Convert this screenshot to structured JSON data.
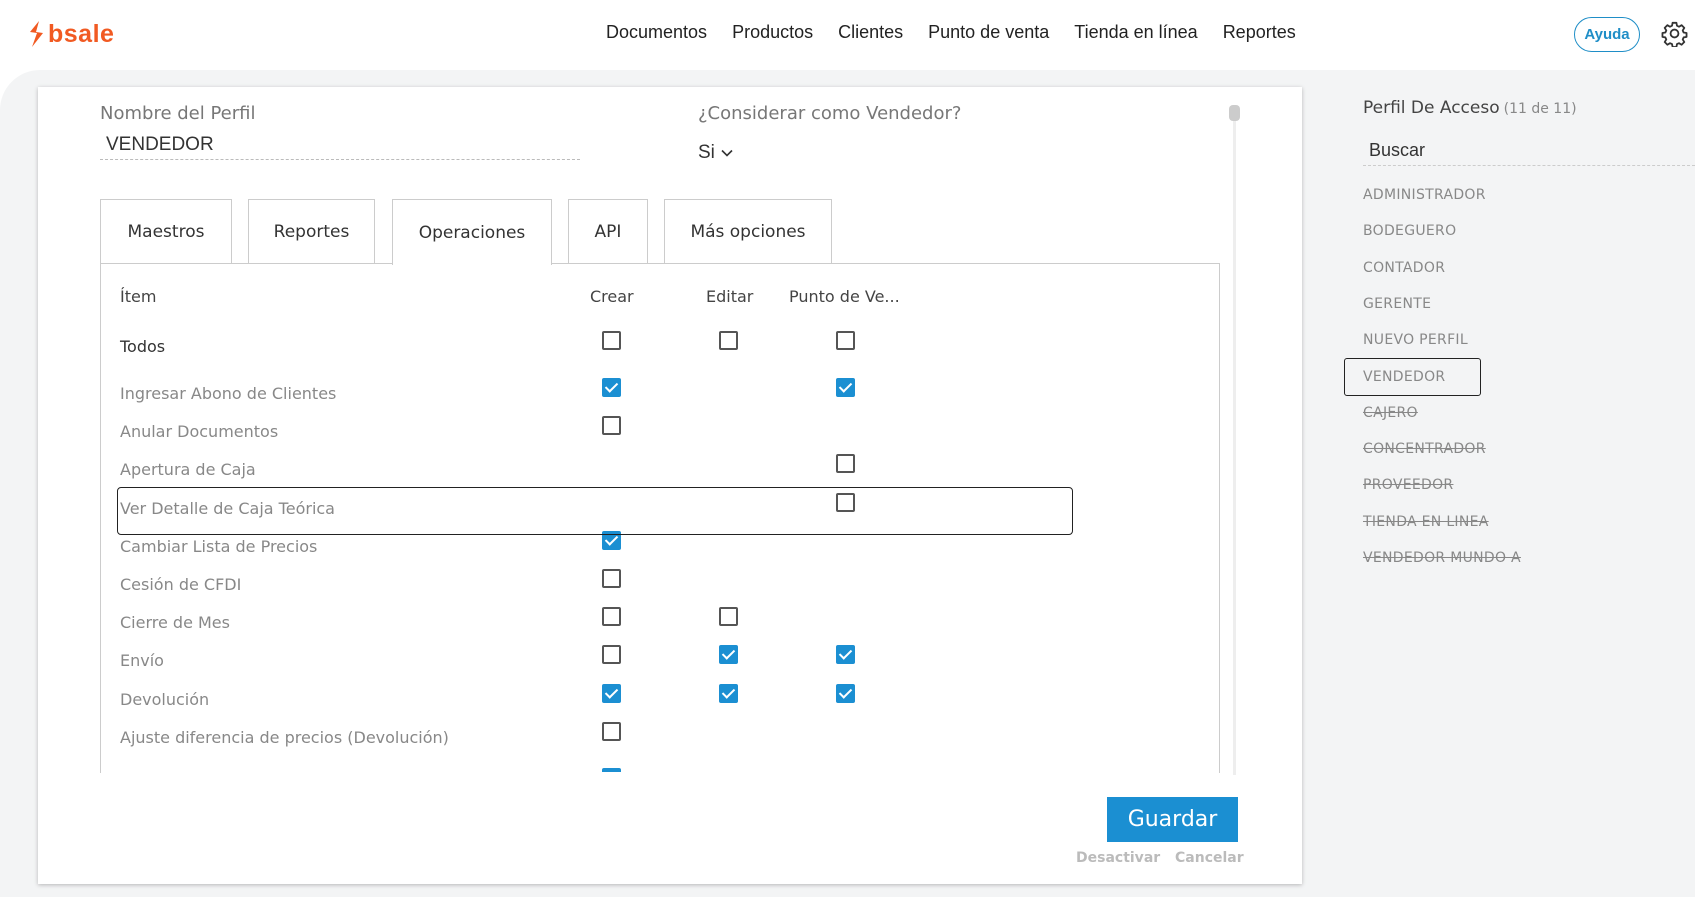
{
  "app": {
    "logo_text": "bsale",
    "brand_color": "#f15a22",
    "accent_color": "#1b8fd2"
  },
  "nav": [
    "Documentos",
    "Productos",
    "Clientes",
    "Punto de venta",
    "Tienda en línea",
    "Reportes"
  ],
  "header": {
    "help_label": "Ayuda",
    "settings_icon": "gear-icon"
  },
  "form": {
    "profile_name_label": "Nombre del Perfil",
    "profile_name_value": "VENDEDOR",
    "seller_label": "¿Considerar como Vendedor?",
    "seller_value": "Si"
  },
  "tabs": [
    "Maestros",
    "Reportes",
    "Operaciones",
    "API",
    "Más opciones"
  ],
  "active_tab": "Operaciones",
  "table": {
    "headers": {
      "item": "Ítem",
      "crear": "Crear",
      "editar": "Editar",
      "punto": "Punto de Ve..."
    },
    "todos_label": "Todos",
    "rows": [
      {
        "label": "Ingresar Abono de Clientes",
        "crear": true,
        "editar": null,
        "punto": true
      },
      {
        "label": "Anular Documentos",
        "crear": false,
        "editar": null,
        "punto": null
      },
      {
        "label": "Apertura de Caja",
        "crear": null,
        "editar": null,
        "punto": false
      },
      {
        "label": "Ver Detalle de Caja Teórica",
        "crear": null,
        "editar": null,
        "punto": false
      },
      {
        "label": "Cambiar Lista de Precios",
        "crear": true,
        "editar": null,
        "punto": null
      },
      {
        "label": "Cesión de CFDI",
        "crear": false,
        "editar": null,
        "punto": null
      },
      {
        "label": "Cierre de Mes",
        "crear": false,
        "editar": false,
        "punto": null
      },
      {
        "label": "Envío",
        "crear": false,
        "editar": true,
        "punto": true
      },
      {
        "label": "Devolución",
        "crear": true,
        "editar": true,
        "punto": true
      },
      {
        "label": "Ajuste diferencia de precios (Devolución)",
        "crear": false,
        "editar": null,
        "punto": null
      }
    ]
  },
  "actions": {
    "save_label": "Guardar",
    "deactivate_label": "Desactivar",
    "cancel_label": "Cancelar"
  },
  "sidebar": {
    "title": "Perfil De Acceso",
    "count": "(11 de 11)",
    "search_value": "Buscar",
    "profiles": [
      {
        "label": "ADMINISTRADOR",
        "inactive": false
      },
      {
        "label": "BODEGUERO",
        "inactive": false
      },
      {
        "label": "CONTADOR",
        "inactive": false
      },
      {
        "label": "GERENTE",
        "inactive": false
      },
      {
        "label": "NUEVO PERFIL",
        "inactive": false
      },
      {
        "label": "VENDEDOR",
        "inactive": false,
        "selected": true
      },
      {
        "label": "CAJERO",
        "inactive": true
      },
      {
        "label": "CONCENTRADOR",
        "inactive": true
      },
      {
        "label": "PROVEEDOR",
        "inactive": true
      },
      {
        "label": "TIENDA EN LINEA",
        "inactive": true
      },
      {
        "label": "VENDEDOR MUNDO A",
        "inactive": true
      }
    ]
  }
}
